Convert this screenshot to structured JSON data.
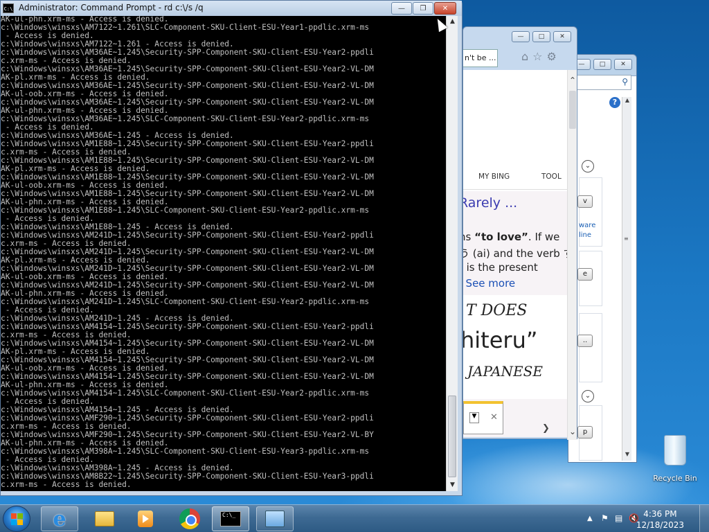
{
  "cmd": {
    "title": "Administrator:  Command Prompt - rd  c:\\/s /q",
    "icon_text": "C:\\",
    "lines": [
      "AK-ul-phn.xrm-ms - Access is denied.",
      "c:\\Windows\\winsxs\\AM7122~1.261\\SLC-Component-SKU-Client-ESU-Year1-ppdlic.xrm-ms",
      " - Access is denied.",
      "c:\\Windows\\winsxs\\AM7122~1.261 - Access is denied.",
      "c:\\Windows\\winsxs\\AM36AE~1.245\\Security-SPP-Component-SKU-Client-ESU-Year2-ppdli",
      "c.xrm-ms - Access is denied.",
      "c:\\Windows\\winsxs\\AM36AE~1.245\\Security-SPP-Component-SKU-Client-ESU-Year2-VL-DM",
      "AK-pl.xrm-ms - Access is denied.",
      "c:\\Windows\\winsxs\\AM36AE~1.245\\Security-SPP-Component-SKU-Client-ESU-Year2-VL-DM",
      "AK-ul-oob.xrm-ms - Access is denied.",
      "c:\\Windows\\winsxs\\AM36AE~1.245\\Security-SPP-Component-SKU-Client-ESU-Year2-VL-DM",
      "AK-ul-phn.xrm-ms - Access is denied.",
      "c:\\Windows\\winsxs\\AM36AE~1.245\\SLC-Component-SKU-Client-ESU-Year2-ppdlic.xrm-ms",
      " - Access is denied.",
      "c:\\Windows\\winsxs\\AM36AE~1.245 - Access is denied.",
      "c:\\Windows\\winsxs\\AM1E88~1.245\\Security-SPP-Component-SKU-Client-ESU-Year2-ppdli",
      "c.xrm-ms - Access is denied.",
      "c:\\Windows\\winsxs\\AM1E88~1.245\\Security-SPP-Component-SKU-Client-ESU-Year2-VL-DM",
      "AK-pl.xrm-ms - Access is denied.",
      "c:\\Windows\\winsxs\\AM1E88~1.245\\Security-SPP-Component-SKU-Client-ESU-Year2-VL-DM",
      "AK-ul-oob.xrm-ms - Access is denied.",
      "c:\\Windows\\winsxs\\AM1E88~1.245\\Security-SPP-Component-SKU-Client-ESU-Year2-VL-DM",
      "AK-ul-phn.xrm-ms - Access is denied.",
      "c:\\Windows\\winsxs\\AM1E88~1.245\\SLC-Component-SKU-Client-ESU-Year2-ppdlic.xrm-ms",
      " - Access is denied.",
      "c:\\Windows\\winsxs\\AM1E88~1.245 - Access is denied.",
      "c:\\Windows\\winsxs\\AM241D~1.245\\Security-SPP-Component-SKU-Client-ESU-Year2-ppdli",
      "c.xrm-ms - Access is denied.",
      "c:\\Windows\\winsxs\\AM241D~1.245\\Security-SPP-Component-SKU-Client-ESU-Year2-VL-DM",
      "AK-pl.xrm-ms - Access is denied.",
      "c:\\Windows\\winsxs\\AM241D~1.245\\Security-SPP-Component-SKU-Client-ESU-Year2-VL-DM",
      "AK-ul-oob.xrm-ms - Access is denied.",
      "c:\\Windows\\winsxs\\AM241D~1.245\\Security-SPP-Component-SKU-Client-ESU-Year2-VL-DM",
      "AK-ul-phn.xrm-ms - Access is denied.",
      "c:\\Windows\\winsxs\\AM241D~1.245\\SLC-Component-SKU-Client-ESU-Year2-ppdlic.xrm-ms",
      " - Access is denied.",
      "c:\\Windows\\winsxs\\AM241D~1.245 - Access is denied.",
      "c:\\Windows\\winsxs\\AM4154~1.245\\Security-SPP-Component-SKU-Client-ESU-Year2-ppdli",
      "c.xrm-ms - Access is denied.",
      "c:\\Windows\\winsxs\\AM4154~1.245\\Security-SPP-Component-SKU-Client-ESU-Year2-VL-DM",
      "AK-pl.xrm-ms - Access is denied.",
      "c:\\Windows\\winsxs\\AM4154~1.245\\Security-SPP-Component-SKU-Client-ESU-Year2-VL-DM",
      "AK-ul-oob.xrm-ms - Access is denied.",
      "c:\\Windows\\winsxs\\AM4154~1.245\\Security-SPP-Component-SKU-Client-ESU-Year2-VL-DM",
      "AK-ul-phn.xrm-ms - Access is denied.",
      "c:\\Windows\\winsxs\\AM4154~1.245\\SLC-Component-SKU-Client-ESU-Year2-ppdlic.xrm-ms",
      " - Access is denied.",
      "c:\\Windows\\winsxs\\AM4154~1.245 - Access is denied.",
      "c:\\Windows\\winsxs\\AMF290~1.245\\Security-SPP-Component-SKU-Client-ESU-Year2-ppdli",
      "c.xrm-ms - Access is denied.",
      "c:\\Windows\\winsxs\\AMF290~1.245\\Security-SPP-Component-SKU-Client-ESU-Year2-VL-BY",
      "AK-ul-phn.xrm-ms - Access is denied.",
      "c:\\Windows\\winsxs\\AM398A~1.245\\SLC-Component-SKU-Client-ESU-Year3-ppdlic.xrm-ms",
      " - Access is denied.",
      "c:\\Windows\\winsxs\\AM398A~1.245 - Access is denied.",
      "c:\\Windows\\winsxs\\AM8B22~1.245\\Security-SPP-Component-SKU-Client-ESU-Year3-ppdli",
      "c.xrm-ms - Access is denied."
    ]
  },
  "ie": {
    "tab_label": "n't be ...",
    "nav_my_bing": "MY BING",
    "nav_tools": "TOOL",
    "result_title": "Rarely ...",
    "line1_pre": "ns ",
    "line1_bold": "“to love”",
    "line1_post": ". If we",
    "line2": "う (ai) and the verb す",
    "line3": ") is the present",
    "see_more": "See more",
    "img_text1": "T DOES",
    "img_text2": "hiteru”",
    "img_text3": "JAPANESE"
  },
  "side": {
    "btn1": "v",
    "link1": "ware",
    "link2": "line",
    "btn2": "e",
    "btn3": "..",
    "btn4": "p"
  },
  "desktop": {
    "recycle_label": "Recycle Bin"
  },
  "taskbar": {
    "time": "4:36 PM",
    "date": "12/18/2023",
    "cmd_icon_text": "C:\\_"
  }
}
